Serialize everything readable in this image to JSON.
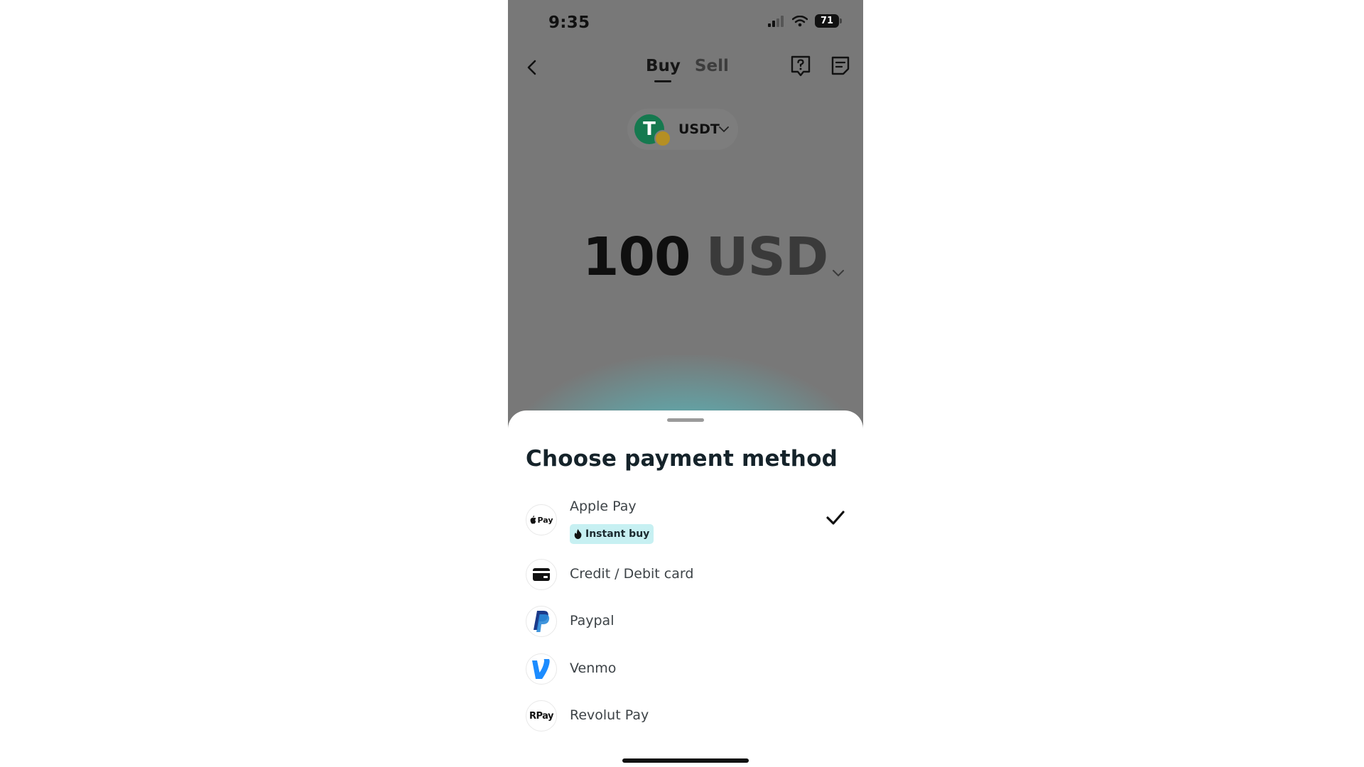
{
  "status_bar": {
    "time": "9:35",
    "battery": "71"
  },
  "nav": {
    "tabs": [
      {
        "label": "Buy",
        "active": true
      },
      {
        "label": "Sell",
        "active": false
      }
    ]
  },
  "asset": {
    "symbol": "USDT",
    "logo_glyph": "T"
  },
  "amount": {
    "value": "100",
    "currency": "USD"
  },
  "sheet": {
    "title": "Choose payment method",
    "methods": [
      {
        "label": "Apple Pay",
        "icon": "apple-pay-icon",
        "icon_text": "Pay",
        "badge": "Instant buy",
        "selected": true
      },
      {
        "label": "Credit / Debit card",
        "icon": "card-icon",
        "selected": false
      },
      {
        "label": "Paypal",
        "icon": "paypal-icon",
        "selected": false
      },
      {
        "label": "Venmo",
        "icon": "venmo-icon",
        "selected": false
      },
      {
        "label": "Revolut Pay",
        "icon": "revolut-pay-icon",
        "icon_text": "RPay",
        "selected": false
      }
    ]
  },
  "colors": {
    "overlay": "#787878",
    "accent_glow": "#28d7e1",
    "badge_bg": "#c7f0f2",
    "tether_green": "#15794f",
    "paypal_dark": "#1b3a8a",
    "paypal_light": "#2b8ad8",
    "venmo_blue": "#1c8cff"
  }
}
